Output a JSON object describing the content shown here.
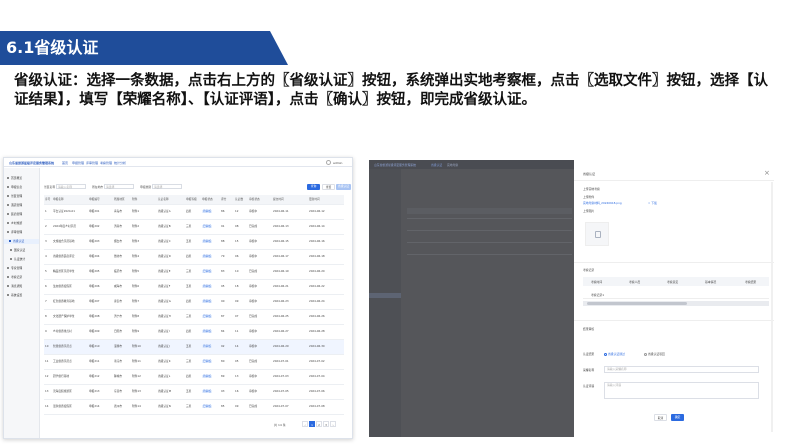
{
  "slide": {
    "section_title": "6.1省级认证",
    "description": "省级认证：选择一条数据，点击右上方的〖省级认证〗按钮，系统弹出实地考察框，点击〖选取文件〗按钮，选择【认证结果】，填写【荣耀名称】、【认证评语】，点击〖确认〗按钮，即完成省级认证。"
  },
  "shot1": {
    "app_name": "山东省旅游星级评定服务管理系统",
    "nav": [
      "首页",
      "申报管理",
      "评审管理",
      "考察管理",
      "统计分析"
    ],
    "user": "admin",
    "sidebar": [
      "首页概览",
      "申报信息",
      "景区管理",
      "酒店管理",
      "民宿管理",
      "乡村旅游",
      "评审管理",
      "省级认证",
      "国家认证",
      "认证统计",
      "专家管理",
      "考察记录",
      "消息通知",
      "系统设置"
    ],
    "sidebar_active": 7,
    "search": {
      "label1": "景区名称",
      "placeholder1": "请输入名称",
      "label2": "所在地市",
      "placeholder2": "请选择",
      "label3": "申报类别",
      "placeholder3": "请选择"
    },
    "btn_query": "查询",
    "btn_reset": "重置",
    "btn_certify": "省级认证",
    "columns": [
      "序号",
      "申报名称",
      "申报编号",
      "所属地区",
      "附件",
      "认证名称",
      "申报等级",
      "申报状态",
      "评分",
      "认证数",
      "审核状态",
      "提交时间",
      "更新时间"
    ],
    "rows": [
      [
        "1",
        "平台认证2024-01",
        "申报201",
        "青岛市",
        "附件1",
        "省级认证A",
        "四星",
        "待审核",
        "86",
        "12",
        "审核中",
        "2024-06-11",
        "2024-06-12"
      ],
      [
        "2",
        "2024年度乡村示范",
        "申报202",
        "济南市",
        "附件2",
        "省级认证B",
        "三星",
        "已审核",
        "91",
        "08",
        "已完成",
        "2024-06-13",
        "2024-06-14"
      ],
      [
        "3",
        "文旅融合示范基地",
        "申报203",
        "烟台市",
        "附件3",
        "省级认证C",
        "五星",
        "待审核",
        "88",
        "15",
        "审核中",
        "2024-06-15",
        "2024-06-16"
      ],
      [
        "4",
        "省级旅游民宿评定",
        "申报204",
        "潍坊市",
        "附件4",
        "省级认证D",
        "四星",
        "待审核",
        "79",
        "06",
        "审核中",
        "2024-06-17",
        "2024-06-18"
      ],
      [
        "5",
        "精品景区示范单位",
        "申报205",
        "临沂市",
        "附件5",
        "省级认证E",
        "三星",
        "已审核",
        "83",
        "10",
        "已完成",
        "2024-06-19",
        "2024-06-20"
      ],
      [
        "6",
        "生态旅游度假区",
        "申报206",
        "威海市",
        "附件6",
        "省级认证F",
        "五星",
        "待审核",
        "95",
        "18",
        "审核中",
        "2024-06-21",
        "2024-06-22"
      ],
      [
        "7",
        "红色旅游教育基地",
        "申报207",
        "泰安市",
        "附件7",
        "省级认证G",
        "四星",
        "待审核",
        "90",
        "09",
        "审核中",
        "2024-06-23",
        "2024-06-24"
      ],
      [
        "8",
        "文化遗产保护单位",
        "申报208",
        "济宁市",
        "附件8",
        "省级认证H",
        "三星",
        "已审核",
        "87",
        "07",
        "已完成",
        "2024-06-25",
        "2024-06-26"
      ],
      [
        "9",
        "乡村旅游重点村",
        "申报209",
        "日照市",
        "附件9",
        "省级认证I",
        "四星",
        "待审核",
        "84",
        "11",
        "审核中",
        "2024-06-27",
        "2024-06-28"
      ],
      [
        "10",
        "智慧旅游示范点",
        "申报210",
        "淄博市",
        "附件10",
        "省级认证J",
        "五星",
        "待审核",
        "92",
        "14",
        "审核中",
        "2024-06-29",
        "2024-06-30"
      ],
      [
        "11",
        "工业旅游示范点",
        "申报211",
        "枣庄市",
        "附件11",
        "省级认证K",
        "三星",
        "已审核",
        "80",
        "05",
        "已完成",
        "2024-07-01",
        "2024-07-02"
      ],
      [
        "12",
        "研学旅行基地",
        "申报212",
        "聊城市",
        "附件12",
        "省级认证L",
        "四星",
        "待审核",
        "89",
        "13",
        "审核中",
        "2024-07-03",
        "2024-07-04"
      ],
      [
        "13",
        "滨海度假旅游区",
        "申报213",
        "东营市",
        "附件13",
        "省级认证M",
        "五星",
        "待审核",
        "93",
        "16",
        "审核中",
        "2024-07-05",
        "2024-07-06"
      ],
      [
        "14",
        "温泉旅游度假区",
        "申报214",
        "德州市",
        "附件14",
        "省级认证N",
        "三星",
        "已审核",
        "85",
        "09",
        "已完成",
        "2024-07-07",
        "2024-07-08"
      ]
    ],
    "pagination": {
      "total": "共 14 条",
      "pages": [
        "1",
        "2",
        "3"
      ],
      "current": 1
    }
  },
  "shot2": {
    "app_name": "山东省旅游星级评定服务管理系统",
    "tabs": [
      "省级认证",
      "实地考察"
    ],
    "drawer": {
      "title": "省级认证",
      "close": "×",
      "upload_label": "上传实地考察",
      "file_label": "上传附件",
      "file_name": "实地考察材料_20240618.png",
      "download": "下载",
      "image_label": "上传图片",
      "section_record": "考察记录",
      "record_columns": [
        "考察时间",
        "考察人员",
        "考察意见",
        "基本情况",
        "考察结果"
      ],
      "record_row": [
        "考察记录1",
        "",
        "",
        "",
        ""
      ],
      "section_result": "结果审核",
      "result_label": "认证结果",
      "opt_pass": "省级认证通过",
      "opt_fail": "省级认证驳回",
      "honor_label": "荣耀名称",
      "honor_placeholder": "请输入荣耀名称",
      "comment_label": "认证评语",
      "comment_placeholder": "请输入评语",
      "btn_cancel": "取消",
      "btn_confirm": "确定"
    }
  },
  "colors": {
    "brand": "#1f4d9a",
    "primary": "#2b6ae0",
    "overlay": "#55565a"
  }
}
